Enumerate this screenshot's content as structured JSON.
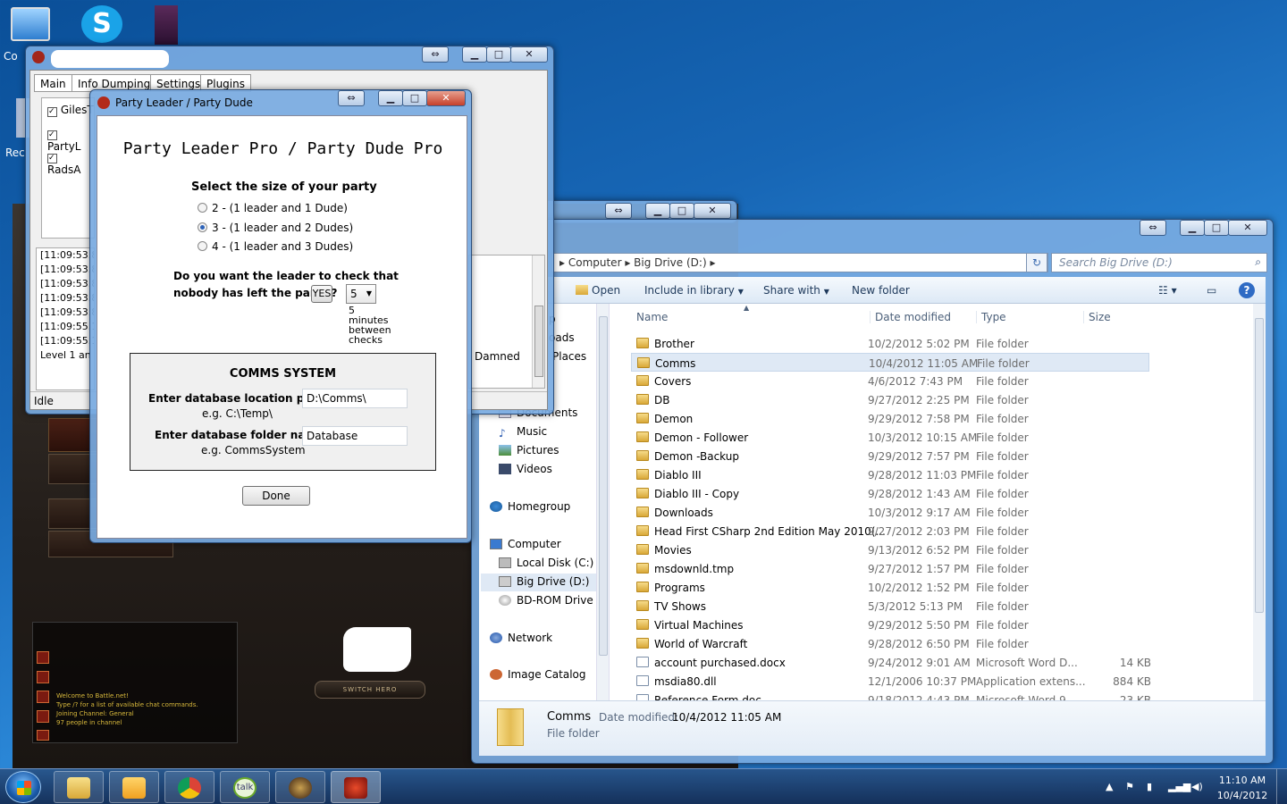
{
  "desktop": {
    "icons": [
      {
        "label": "Co"
      },
      {
        "label": "Rec"
      }
    ]
  },
  "bot_window": {
    "tabs": [
      "Main",
      "Info Dumping",
      "Settings",
      "Plugins"
    ],
    "checkboxes": [
      "GilesT",
      "PartyL",
      "RadsA"
    ],
    "log_lines": [
      "[11:09:53.8",
      "[11:09:53.8",
      "[11:09:53.8",
      "[11:09:53.8",
      "[11:09:53.8",
      "[11:09:55.1",
      "[11:09:55.1",
      "Level 1 an"
    ],
    "status": "Idle",
    "side_text": "Damned"
  },
  "party_dialog": {
    "title": "Party Leader / Party Dude",
    "heading": "Party Leader Pro / Party Dude Pro",
    "size_prompt": "Select the size of your party",
    "options": [
      {
        "label": "2 - (1 leader and 1 Dude)",
        "selected": false
      },
      {
        "label": "3 - (1 leader and 2 Dudes)",
        "selected": true
      },
      {
        "label": "4 - (1 leader and 3 Dudes)",
        "selected": false
      }
    ],
    "check_question_1": "Do you want the leader to check that",
    "check_question_2": "nobody has left the party ?",
    "yes_button": "YES",
    "minutes_value": "5",
    "minutes_note": [
      "5",
      "minutes",
      "between",
      "checks"
    ],
    "comms_title": "COMMS SYSTEM",
    "db_path_label": "Enter database location path",
    "db_path_example": "e.g. C:\\Temp\\",
    "db_path_value": "D:\\Comms\\",
    "db_folder_label": "Enter database folder name",
    "db_folder_example": "e.g. CommsSystem",
    "db_folder_value": "Database",
    "done_button": "Done"
  },
  "explorer": {
    "breadcrumb": [
      "Computer",
      "Big Drive (D:)"
    ],
    "search_placeholder": "Search Big Drive (D:)",
    "commands": {
      "open": "Open",
      "include": "Include in library",
      "share": "Share with",
      "new_folder": "New folder"
    },
    "nav_partial": [
      "p",
      "oads",
      "Places"
    ],
    "nav": {
      "libraries": [
        "Documents",
        "Music",
        "Pictures",
        "Videos"
      ],
      "homegroup": "Homegroup",
      "computer": "Computer",
      "drives": [
        "Local Disk (C:)",
        "Big Drive (D:)",
        "BD-ROM Drive (("
      ],
      "network": "Network",
      "image_catalog": "Image Catalog"
    },
    "columns": [
      "Name",
      "Date modified",
      "Type",
      "Size"
    ],
    "files": [
      {
        "name": "Brother",
        "date": "10/2/2012 5:02 PM",
        "type": "File folder",
        "size": "",
        "icon": "folder-icon"
      },
      {
        "name": "Comms",
        "date": "10/4/2012 11:05 AM",
        "type": "File folder",
        "size": "",
        "icon": "folder-icon",
        "selected": true
      },
      {
        "name": "Covers",
        "date": "4/6/2012 7:43 PM",
        "type": "File folder",
        "size": "",
        "icon": "folder-icon"
      },
      {
        "name": "DB",
        "date": "9/27/2012 2:25 PM",
        "type": "File folder",
        "size": "",
        "icon": "folder-icon"
      },
      {
        "name": "Demon",
        "date": "9/29/2012 7:58 PM",
        "type": "File folder",
        "size": "",
        "icon": "folder-icon"
      },
      {
        "name": "Demon - Follower",
        "date": "10/3/2012 10:15 AM",
        "type": "File folder",
        "size": "",
        "icon": "folder-icon"
      },
      {
        "name": "Demon -Backup",
        "date": "9/29/2012 7:57 PM",
        "type": "File folder",
        "size": "",
        "icon": "folder-icon"
      },
      {
        "name": "Diablo III",
        "date": "9/28/2012 11:03 PM",
        "type": "File folder",
        "size": "",
        "icon": "folder-icon"
      },
      {
        "name": "Diablo III - Copy",
        "date": "9/28/2012 1:43 AM",
        "type": "File folder",
        "size": "",
        "icon": "folder-icon"
      },
      {
        "name": "Downloads",
        "date": "10/3/2012 9:17 AM",
        "type": "File folder",
        "size": "",
        "icon": "folder-icon"
      },
      {
        "name": "Head First CSharp 2nd Edition May 2010(...",
        "date": "9/27/2012 2:03 PM",
        "type": "File folder",
        "size": "",
        "icon": "folder-icon"
      },
      {
        "name": "Movies",
        "date": "9/13/2012 6:52 PM",
        "type": "File folder",
        "size": "",
        "icon": "folder-icon"
      },
      {
        "name": "msdownld.tmp",
        "date": "9/27/2012 1:57 PM",
        "type": "File folder",
        "size": "",
        "icon": "folder-icon"
      },
      {
        "name": "Programs",
        "date": "10/2/2012 1:52 PM",
        "type": "File folder",
        "size": "",
        "icon": "folder-icon"
      },
      {
        "name": "TV Shows",
        "date": "5/3/2012 5:13 PM",
        "type": "File folder",
        "size": "",
        "icon": "folder-icon"
      },
      {
        "name": "Virtual Machines",
        "date": "9/29/2012 5:50 PM",
        "type": "File folder",
        "size": "",
        "icon": "folder-icon"
      },
      {
        "name": "World of Warcraft",
        "date": "9/28/2012 6:50 PM",
        "type": "File folder",
        "size": "",
        "icon": "folder-icon"
      },
      {
        "name": "account purchased.docx",
        "date": "9/24/2012 9:01 AM",
        "type": "Microsoft Word D...",
        "size": "14 KB",
        "icon": "word-doc-icon"
      },
      {
        "name": "msdia80.dll",
        "date": "12/1/2006 10:37 PM",
        "type": "Application extens...",
        "size": "884 KB",
        "icon": "dll-icon"
      },
      {
        "name": "Reference Form.doc",
        "date": "9/18/2012 4:43 PM",
        "type": "Microsoft Word 9...",
        "size": "23 KB",
        "icon": "word-doc-icon"
      }
    ],
    "details": {
      "name": "Comms",
      "modified_label": "Date modified:",
      "modified": "10/4/2012 11:05 AM",
      "type": "File folder"
    }
  },
  "game": {
    "switch_hero": "SWITCH HERO",
    "chat": [
      "Welcome to Battle.net!",
      "Type /? for a list of available chat commands.",
      "Joining Channel: General",
      "97 people in channel"
    ]
  },
  "taskbar": {
    "time": "11:10 AM",
    "date": "10/4/2012"
  }
}
